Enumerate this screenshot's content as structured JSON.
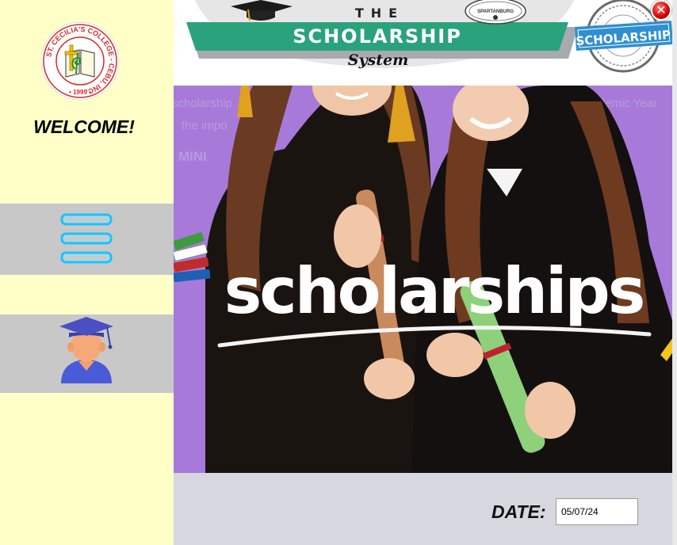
{
  "sidebar": {
    "logo": {
      "ring_text": "ST. CECILIA'S COLLEGE - CEBU, INC.",
      "year": "• 1999 •"
    },
    "welcome": "WELCOME!",
    "nav": [
      {
        "icon": "menu-icon"
      },
      {
        "icon": "graduate-student-icon"
      }
    ]
  },
  "header": {
    "the": "THE",
    "title": "SCHOLARSHIP",
    "subtitle": "System",
    "badge_text": "SPARTANBURG",
    "stamp_text": "SCHOLARSHIP"
  },
  "hero": {
    "headline": "scholarships",
    "background_text": [
      "scholarship",
      "the impo",
      "MINI",
      "Academic Year"
    ]
  },
  "footer": {
    "date_label": "DATE:",
    "date_value": "05/07/24"
  },
  "window": {
    "close_symbol": "✕"
  },
  "colors": {
    "sidebar_bg": "#ffffc8",
    "nav_bg": "#c8c8c8",
    "footer_bg": "#d7d8df",
    "hero_bg": "#9b6ad6",
    "banner_green": "#2aa37c",
    "close_red": "#d40000"
  }
}
